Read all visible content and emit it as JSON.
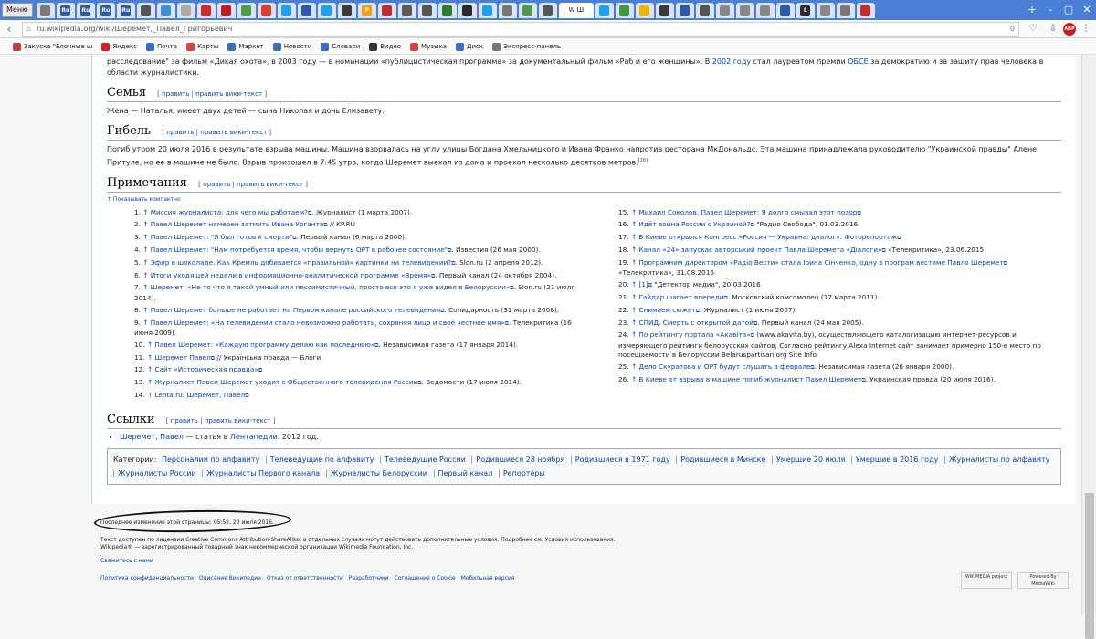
{
  "browser": {
    "menu_label": "Меню",
    "active_tab_title": "W Ш",
    "tabs": [
      {
        "label": "",
        "color": "#7a7a7a"
      },
      {
        "label": "Ru",
        "color": "#2a5aa8"
      },
      {
        "label": "Ru",
        "color": "#2a5aa8"
      },
      {
        "label": "Ru",
        "color": "#2a5aa8"
      },
      {
        "label": "Ru",
        "color": "#2a5aa8"
      },
      {
        "label": "",
        "color": "#555555"
      },
      {
        "label": "",
        "color": "#3a8fd6"
      },
      {
        "label": "",
        "color": "#aaaaaa"
      },
      {
        "label": "",
        "color": "#d22a2a"
      },
      {
        "label": "",
        "color": "#c71a1a"
      },
      {
        "label": "",
        "color": "#4a9d4a"
      },
      {
        "label": "",
        "color": "#e33b2b"
      },
      {
        "label": "",
        "color": "#1da1f2"
      },
      {
        "label": "",
        "color": "#2a5aa8"
      },
      {
        "label": "",
        "color": "#1da1f2"
      },
      {
        "label": "",
        "color": "#3a3a3a"
      },
      {
        "label": "P",
        "color": "#ff9900"
      },
      {
        "label": "",
        "color": "#c72a2a"
      },
      {
        "label": "",
        "color": "#5a5a5a"
      },
      {
        "label": "",
        "color": "#555555"
      },
      {
        "label": "",
        "color": "#2a7d2a"
      },
      {
        "label": "",
        "color": "#2a2a2a"
      },
      {
        "label": "",
        "color": "#1da1f2"
      },
      {
        "label": "",
        "color": "#777777"
      },
      {
        "label": "",
        "color": "#4a9d4a"
      },
      {
        "label": "",
        "color": "#555555"
      }
    ],
    "tabs_right": [
      {
        "label": "",
        "color": "#1da1f2"
      },
      {
        "label": "",
        "color": "#3d9a3d"
      },
      {
        "label": "",
        "color": "#f0b400"
      },
      {
        "label": "",
        "color": "#3a3a3a"
      },
      {
        "label": "",
        "color": "#2a5aa8"
      },
      {
        "label": "",
        "color": "#555555"
      },
      {
        "label": "",
        "color": "#888888"
      },
      {
        "label": "",
        "color": "#888888"
      },
      {
        "label": "",
        "color": "#888888"
      },
      {
        "label": "",
        "color": "#2a5aa8"
      },
      {
        "label": "L",
        "color": "#2a2a2a"
      },
      {
        "label": "",
        "color": "#888888"
      },
      {
        "label": "",
        "color": "#777777"
      },
      {
        "label": "",
        "color": "#c72a2a"
      }
    ],
    "url": "ru.wikipedia.org/wiki/Шеремет,_Павел_Григорьевич",
    "url_counter": "0",
    "abp_label": "ABP"
  },
  "bookmarks": [
    {
      "label": "Закуска \"Ёлочные ш",
      "color": "#c04040"
    },
    {
      "label": "Яндекс",
      "color": "#e02020"
    },
    {
      "label": "Почта",
      "color": "#3a6fc4"
    },
    {
      "label": "Карты",
      "color": "#e04040"
    },
    {
      "label": "Маркет",
      "color": "#3a6fc4"
    },
    {
      "label": "Новости",
      "color": "#3a6fc4"
    },
    {
      "label": "Словари",
      "color": "#3a6fc4"
    },
    {
      "label": "Видео",
      "color": "#333333"
    },
    {
      "label": "Музыка",
      "color": "#e04040"
    },
    {
      "label": "Диск",
      "color": "#3a6fc4"
    },
    {
      "label": "Экспресс-панель",
      "color": "#777777"
    }
  ],
  "intro": {
    "a": "расследование\" за фильм «Дикая охота», в 2003 году — в номинации «публицистическая программа» за документальный фильм «Раб и его женщины». В ",
    "link_year": "2002 году",
    "b": " стал лауреатом премии ",
    "link_obse": "ОБСЕ",
    "c": " за демократию и за защиту прав человека в области журналистики."
  },
  "edit": {
    "edit": "править",
    "sep": "|",
    "edit_wiki": "править вики-текст"
  },
  "sections": {
    "family": {
      "title": "Семья",
      "text": "Жена — Наталья, имеет двух детей — сына Николая и дочь Елизавету."
    },
    "death": {
      "title": "Гибель",
      "text": "Погиб утром 20 июля 2016 в результате взрыва машины. Машина взорвалась на углу улицы Богдана Хмельницкого и Ивана Франко напротив ресторана МкДональдс. Эта машина принадлежала руководителю \"Украинской правды\" Алене Притуле, но ее в машине не было. Взрыв произошел в 7:45 утра, когда Шеремет выехал из дома и проехал несколько десятков метров.",
      "ref": "[26]"
    },
    "notes": {
      "title": "Примечания",
      "collapse": "↑ Показывать компактно"
    },
    "links": {
      "title": "Ссылки",
      "item_link": "Шеремет, Павел",
      "item_text": " — статья в ",
      "item_link2": "Лентапедии",
      "item_tail": ". 2012 год."
    }
  },
  "refs_left": [
    {
      "n": "1.",
      "link": "Миссия журналиста: для чего мы работаем?",
      "rest": ". Журналист (1 марта 2007)."
    },
    {
      "n": "2.",
      "link": "Павел Шеремет намерен затмить Ивана Урганта",
      "rest": " // KP.RU"
    },
    {
      "n": "3.",
      "link": "Павел Шеремет: \"Я был готов к смерти\"",
      "rest": ". Первый канал (6 марта 2000)."
    },
    {
      "n": "4.",
      "link": "Павел Шеремет: \"Нам потребуется время, чтобы вернуть ОРТ в рабочее состояние\"",
      "rest": ". Известия (26 мая 2000)."
    },
    {
      "n": "5.",
      "link": "Эфир в шоколаде. Как Кремль добивается «правильной» картинки на телевидении?",
      "rest": ". Slon.ru (2 апреля 2012)."
    },
    {
      "n": "6.",
      "link": "Итоги уходящей недели в информационно-аналитической программе «Время»",
      "rest": ". Первый канал (24 октября 2004)."
    },
    {
      "n": "7.",
      "link": "Шеремет: «Не то что я такой умный или пессимистичный, просто все это я уже видел в Белоруссии»",
      "rest": ". Slon.ru (21 июля 2014)."
    },
    {
      "n": "8.",
      "link": "Павел Шеремет больше не работает на Первом канале российского телевидения",
      "rest": ". Солидарность (31 марта 2008)."
    },
    {
      "n": "9.",
      "link": "Павел Шеремет: «На телевидении стало невозможно работать, сохраняя лицо и своё честное имя»",
      "rest": ". Телекритика (16 июня 2009)."
    },
    {
      "n": "10.",
      "link": "Павел Шеремет: «Каждую программу делаю как последнюю»",
      "rest": ". Независимая газета (17 января 2014)."
    },
    {
      "n": "11.",
      "link": "Шеремет Павел",
      "rest": " // Українська правда — Блоги"
    },
    {
      "n": "12.",
      "link": "Сайт «Историческая правда»",
      "rest": ""
    },
    {
      "n": "13.",
      "link": "Журналист Павел Шеремет уходит с Общественного телевидения России",
      "rest": ". Ведомости (17 июля 2014)."
    },
    {
      "n": "14.",
      "link": "Lenta.ru: Шеремет, Павел",
      "rest": ""
    }
  ],
  "refs_right": [
    {
      "n": "15.",
      "link": "Михаил Соколов. Павел Шеремет: Я долго смывал этот позор",
      "rest": ""
    },
    {
      "n": "16.",
      "link": "Идёт война России с Украиной?",
      "rest": " \"Радио Свобода\", 01.03.2016"
    },
    {
      "n": "17.",
      "link": "В Киеве открылся Конгресс «Россия — Украина: диалог». Фоторепортаж",
      "rest": ""
    },
    {
      "n": "18.",
      "link": "Канал «24» запускає авторський проект Павла Шеремета «Діалоги»",
      "rest": " «Телекритика», 23.06.2015"
    },
    {
      "n": "19.",
      "link": "Програмним директором «Радіо Вести» стала Ірина Сінченко, одну з програм вестиме Павло Шеремет",
      "rest": " «Телекритика», 31.08.2015"
    },
    {
      "n": "20.",
      "link": "[1]",
      "rest": " \"Детектор медиа\", 20.03.2016"
    },
    {
      "n": "21.",
      "link": "Гайдар шагает впереди",
      "rest": ". Московский комсомолец (17 марта 2011)."
    },
    {
      "n": "22.",
      "link": "Снимаем сюжет",
      "rest": ". Журналист (1 июня 2007)."
    },
    {
      "n": "23.",
      "link": "СПИД. Смерть с открытой датой",
      "rest": ". Первый канал (24 мая 2005)."
    },
    {
      "n": "24.",
      "link": "По рейтингу портала «Акавіта»",
      "rest": " (www.akavita.by), осуществляющего каталогизацию интернет-ресурсов и измеряющего рейтинги белорусских сайтов; Согласно рейтингу Alexa Internet сайт занимает примерно 150-е место по посещаемости в Белоруссии Belaruspartisan.org Site Info"
    },
    {
      "n": "25.",
      "link": "Дело Скуратова и ОРТ будут слушать в феврале",
      "rest": ". Независимая газета (26 января 2000)."
    },
    {
      "n": "26.",
      "link": "В Киеве от взрыва в машине погиб журналист Павел Шеремет",
      "rest": ". Украинская правда (20 июля 2016)."
    }
  ],
  "categories": {
    "label": "Категории:",
    "items": [
      "Персоналии по алфавиту",
      "Телеведущие по алфавиту",
      "Телеведущие России",
      "Родившиеся 28 ноября",
      "Родившиеся в 1971 году",
      "Родившиеся в Минске",
      "Умершие 20 июля",
      "Умершие в 2016 году",
      "Журналисты по алфавиту",
      "Журналисты России",
      "Журналисты Первого канала",
      "Журналисты Белоруссии",
      "Первый канал",
      "Репортёры"
    ]
  },
  "footer": {
    "last_modified": "Последнее изменение этой страницы: 05:52, 20 июля 2016.",
    "license_1": "Текст доступен по лицензии Creative Commons Attribution-ShareAlike; в отдельных случаях могут действовать дополнительные условия. Подробнее см. Условия использования.",
    "license_2": "Wikipedia® — зарегистрированный товарный знак некоммерческой организации Wikimedia Foundation, Inc.",
    "contact": "Свяжитесь с нами",
    "links": [
      "Политика конфиденциальности",
      "Описание Википедии",
      "Отказ от ответственности",
      "Разработчики",
      "Соглашение о Cookie",
      "Мобильная версия"
    ],
    "badge_wm": "WIKIMEDIA project",
    "badge_mw": "Powered By MediaWiki"
  }
}
